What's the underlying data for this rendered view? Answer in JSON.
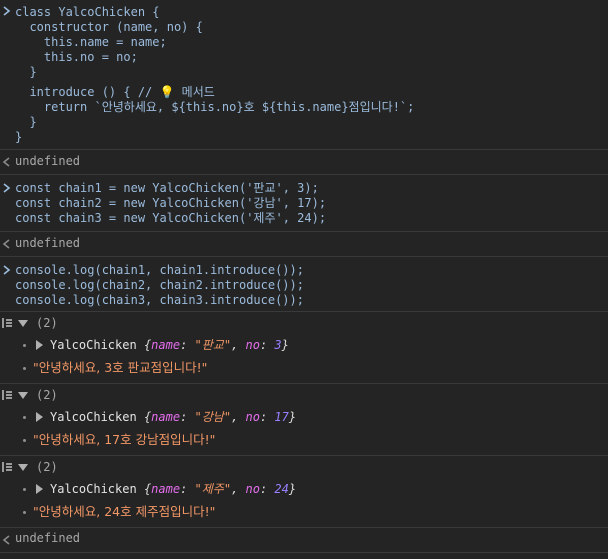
{
  "entries": {
    "class_def": {
      "lines": [
        "class YalcoChicken {",
        "  constructor (name, no) {",
        "    this.name = name;",
        "    this.no = no;",
        "  }",
        "",
        "  introduce () { // ",
        "    return `안녕하세요, ${this.no}호 ${this.name}점입니다!`;",
        "  }",
        "}"
      ],
      "comment_emoji": "💡",
      "comment_text": " 메서드"
    },
    "undefined_1": "undefined",
    "instances": [
      "const chain1 = new YalcoChicken('판교', 3);",
      "const chain2 = new YalcoChicken('강남', 17);",
      "const chain3 = new YalcoChicken('제주', 24);"
    ],
    "undefined_2": "undefined",
    "logs": [
      "console.log(chain1, chain1.introduce());",
      "console.log(chain2, chain2.introduce());",
      "console.log(chain3, chain3.introduce());"
    ],
    "groups": [
      {
        "count": "(2)",
        "class_name": "YalcoChicken",
        "key_name": "name",
        "name_value": "\"판교\"",
        "key_no": "no",
        "no_value": "3",
        "result": "\"안녕하세요, 3호 판교점입니다!\""
      },
      {
        "count": "(2)",
        "class_name": "YalcoChicken",
        "key_name": "name",
        "name_value": "\"강남\"",
        "key_no": "no",
        "no_value": "17",
        "result": "\"안녕하세요, 17호 강남점입니다!\""
      },
      {
        "count": "(2)",
        "class_name": "YalcoChicken",
        "key_name": "name",
        "name_value": "\"제주\"",
        "key_no": "no",
        "no_value": "24",
        "result": "\"안녕하세요, 24호 제주점입니다!\""
      }
    ],
    "undefined_3": "undefined"
  },
  "colors": {
    "background": "#242424",
    "string": "#f29766",
    "number": "#9980ff",
    "key": "#e36eec",
    "prompt": "#9bbbdc"
  }
}
